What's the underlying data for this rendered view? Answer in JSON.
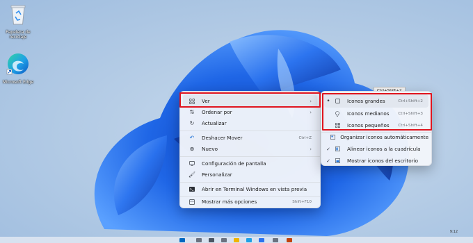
{
  "desktop": {
    "icons": [
      {
        "label": "Papelera de\nreciclaje",
        "icon": "recycle-bin-icon"
      },
      {
        "label": "Microsoft Edge",
        "icon": "edge-icon"
      }
    ]
  },
  "tooltip": {
    "text": "Ctrl+Shift+2"
  },
  "main_menu": {
    "items": [
      {
        "label": "Ver",
        "icon": "grid-icon",
        "arrow": "›"
      },
      {
        "label": "Ordenar por",
        "icon": "sort-icon",
        "arrow": "›"
      },
      {
        "label": "Actualizar",
        "icon": "refresh-icon"
      },
      {
        "label": "Deshacer Mover",
        "icon": "undo-icon",
        "shortcut": "Ctrl+Z"
      },
      {
        "label": "Nuevo",
        "icon": "new-icon",
        "arrow": "›"
      },
      {
        "label": "Configuración de pantalla",
        "icon": "display-icon"
      },
      {
        "label": "Personalizar",
        "icon": "brush-icon"
      },
      {
        "label": "Abrir en Terminal Windows en vista previa",
        "icon": "terminal-icon"
      },
      {
        "label": "Mostrar más opciones",
        "icon": "more-options-icon",
        "shortcut": "Shift+F10"
      }
    ]
  },
  "sub_menu": {
    "items": [
      {
        "label": "Iconos grandes",
        "icon": "monitor-icon",
        "shortcut": "Ctrl+Shift+2",
        "mark": "•"
      },
      {
        "label": "Iconos medianos",
        "icon": "lightbulb-icon",
        "shortcut": "Ctrl+Shift+3",
        "mark": ""
      },
      {
        "label": "Iconos pequeños",
        "icon": "small-grid-icon",
        "shortcut": "Ctrl+Shift+4",
        "mark": ""
      },
      {
        "label": "Organizar iconos automáticamente",
        "icon": "auto-arrange-icon",
        "mark": ""
      },
      {
        "label": "Alinear iconos a la cuadrícula",
        "icon": "align-grid-icon",
        "mark": "✓"
      },
      {
        "label": "Mostrar iconos del escritorio",
        "icon": "desktop-icons-icon",
        "mark": "✓"
      }
    ]
  },
  "taskbar": {
    "time": "9:12"
  },
  "colors": {
    "highlight": "#e0141e",
    "accent": "#0067c0"
  }
}
